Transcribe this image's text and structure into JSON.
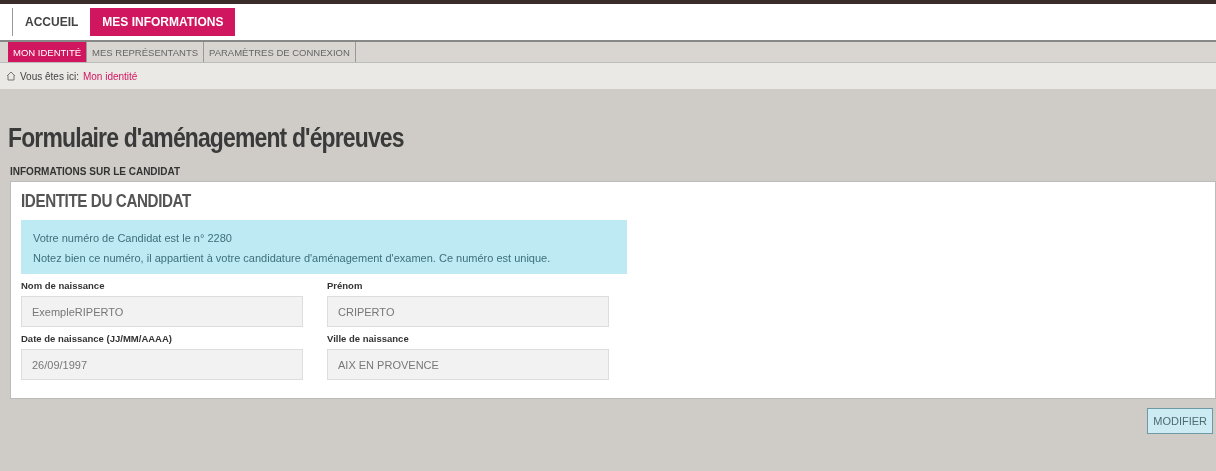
{
  "main_tabs": [
    {
      "label": "ACCUEIL",
      "selected": false
    },
    {
      "label": "MES INFORMATIONS",
      "selected": true
    }
  ],
  "sub_tabs": [
    {
      "label": "MON IDENTITÉ",
      "selected": true
    },
    {
      "label": "MES REPRÉSENTANTS",
      "selected": false
    },
    {
      "label": "PARAMÈTRES DE CONNEXION",
      "selected": false
    }
  ],
  "breadcrumb": {
    "prefix": "Vous êtes ici:",
    "current": "Mon identité"
  },
  "page_title": "Formulaire d'aménagement d'épreuves",
  "section_label": "INFORMATIONS SUR LE CANDIDAT",
  "card": {
    "title": "IDENTITE DU CANDIDAT",
    "notice": [
      "Votre numéro de Candidat est le n° 2280",
      "Notez bien ce numéro, il appartient à votre candidature d'aménagement d'examen. Ce numéro est unique."
    ],
    "fields": [
      {
        "label": "Nom de naissance",
        "value": "ExempleRIPERTO",
        "disabled": true
      },
      {
        "label": "Prénom",
        "value": "CRIPERTO",
        "disabled": true
      },
      {
        "label": "Date de naissance (JJ/MM/AAAA)",
        "value": "26/09/1997",
        "disabled": true
      },
      {
        "label": "Ville de naissance",
        "value": "AIX EN PROVENCE",
        "disabled": true
      }
    ]
  },
  "button": "MODIFIER"
}
